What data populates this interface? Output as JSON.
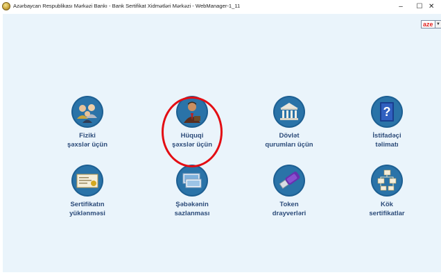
{
  "window": {
    "title": "Azərbaycan Respublikası Mərkəzi Bankı - Bank Sertifikat Xidmətləri Mərkəzi - WebManager-1_11",
    "minimize_glyph": "–",
    "maximize_glyph": "☐",
    "close_glyph": "✕"
  },
  "language": {
    "selected": "aze",
    "arrow": "▼"
  },
  "tiles": [
    {
      "line1": "Fiziki",
      "line2": "şəxslər üçün",
      "icon": "people-group-icon"
    },
    {
      "line1": "Hüquqi",
      "line2": "şəxslər üçün",
      "icon": "businessman-icon"
    },
    {
      "line1": "Dövlət",
      "line2": "qurumları üçün",
      "icon": "government-building-icon"
    },
    {
      "line1": "İstifadəçi",
      "line2": "təlimatı",
      "icon": "help-book-icon"
    },
    {
      "line1": "Sertifikatın",
      "line2": "yüklənməsi",
      "icon": "certificate-icon"
    },
    {
      "line1": "Şəbəkənin",
      "line2": "sazlanması",
      "icon": "network-settings-icon"
    },
    {
      "line1": "Token",
      "line2": "drayverləri",
      "icon": "usb-token-icon"
    },
    {
      "line1": "Kök",
      "line2": "sertifikatlar",
      "icon": "root-certificates-icon"
    }
  ],
  "colors": {
    "background": "#eaf4fb",
    "label": "#2d4c7a",
    "icon_disc": "#1d5f92",
    "highlight": "#e30d13",
    "language_text": "#e0201f"
  }
}
